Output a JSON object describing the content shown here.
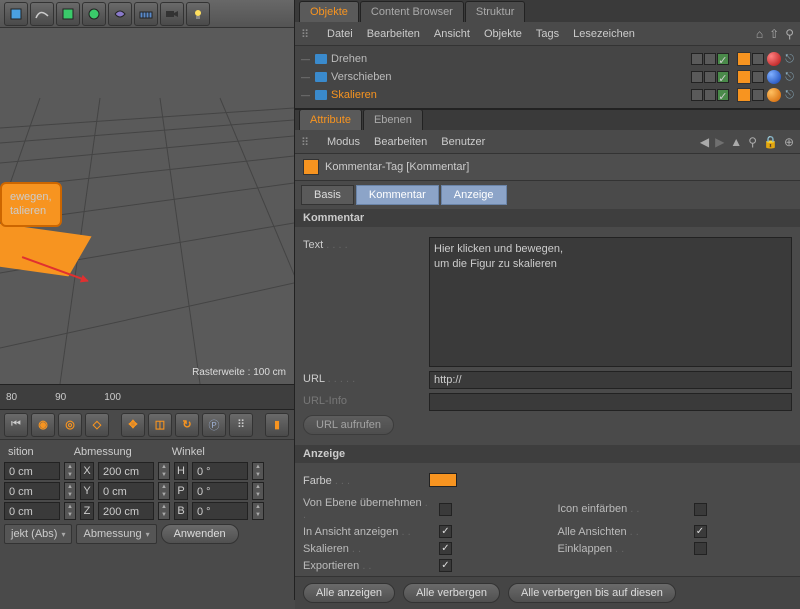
{
  "toolbar_icons": [
    "cube",
    "spline",
    "primitive",
    "generator",
    "deformer",
    "floor",
    "camera",
    "light"
  ],
  "right": {
    "tabs": [
      "Objekte",
      "Content Browser",
      "Struktur"
    ],
    "active_tab": 0,
    "obj_menu": [
      "Datei",
      "Bearbeiten",
      "Ansicht",
      "Objekte",
      "Tags",
      "Lesezeichen"
    ],
    "tree": [
      {
        "name": "Drehen",
        "selected": false,
        "sphere": "red"
      },
      {
        "name": "Verschieben",
        "selected": false,
        "sphere": "blue"
      },
      {
        "name": "Skalieren",
        "selected": true,
        "sphere": "or"
      }
    ],
    "attr_tabs": [
      "Attribute",
      "Ebenen"
    ],
    "attr_active": 0,
    "attr_menu": [
      "Modus",
      "Bearbeiten",
      "Benutzer"
    ],
    "tag_title": "Kommentar-Tag [Kommentar]",
    "subtabs": [
      "Basis",
      "Kommentar",
      "Anzeige"
    ],
    "kommentar": {
      "section": "Kommentar",
      "text_label": "Text",
      "text_value": "Hier klicken und bewegen,\num die Figur zu skalieren",
      "url_label": "URL",
      "url_value": "http://",
      "url_info_label": "URL-Info",
      "url_button": "URL aufrufen"
    },
    "anzeige": {
      "section": "Anzeige",
      "farbe_label": "Farbe",
      "farbe_value": "#f79420",
      "checks": [
        {
          "label": "Von Ebene übernehmen",
          "on": false
        },
        {
          "label": "Icon einfärben",
          "on": false
        },
        {
          "label": "In Ansicht anzeigen",
          "on": true
        },
        {
          "label": "Alle Ansichten",
          "on": true
        },
        {
          "label": "Skalieren",
          "on": true
        },
        {
          "label": "Einklappen",
          "on": false
        },
        {
          "label": "Exportieren",
          "on": true
        }
      ]
    },
    "footer": [
      "Alle anzeigen",
      "Alle verbergen",
      "Alle verbergen bis auf diesen"
    ]
  },
  "viewport": {
    "note_line1": "ewegen,",
    "note_line2": "talieren",
    "status": "Rasterweite : 100 cm"
  },
  "timeline": {
    "ticks": [
      "80",
      "90",
      "100"
    ]
  },
  "coords": {
    "headers": [
      "sition",
      "Abmessung",
      "Winkel"
    ],
    "rows": [
      {
        "axis": "X",
        "pos": "0 cm",
        "dim": "200 cm",
        "ang_axis": "H",
        "ang": "0 °"
      },
      {
        "axis": "Y",
        "pos": "0 cm",
        "dim": "0 cm",
        "ang_axis": "P",
        "ang": "0 °"
      },
      {
        "axis": "Z",
        "pos": "0 cm",
        "dim": "200 cm",
        "ang_axis": "B",
        "ang": "0 °"
      }
    ],
    "mode1": "jekt (Abs)",
    "mode2": "Abmessung",
    "apply": "Anwenden"
  }
}
